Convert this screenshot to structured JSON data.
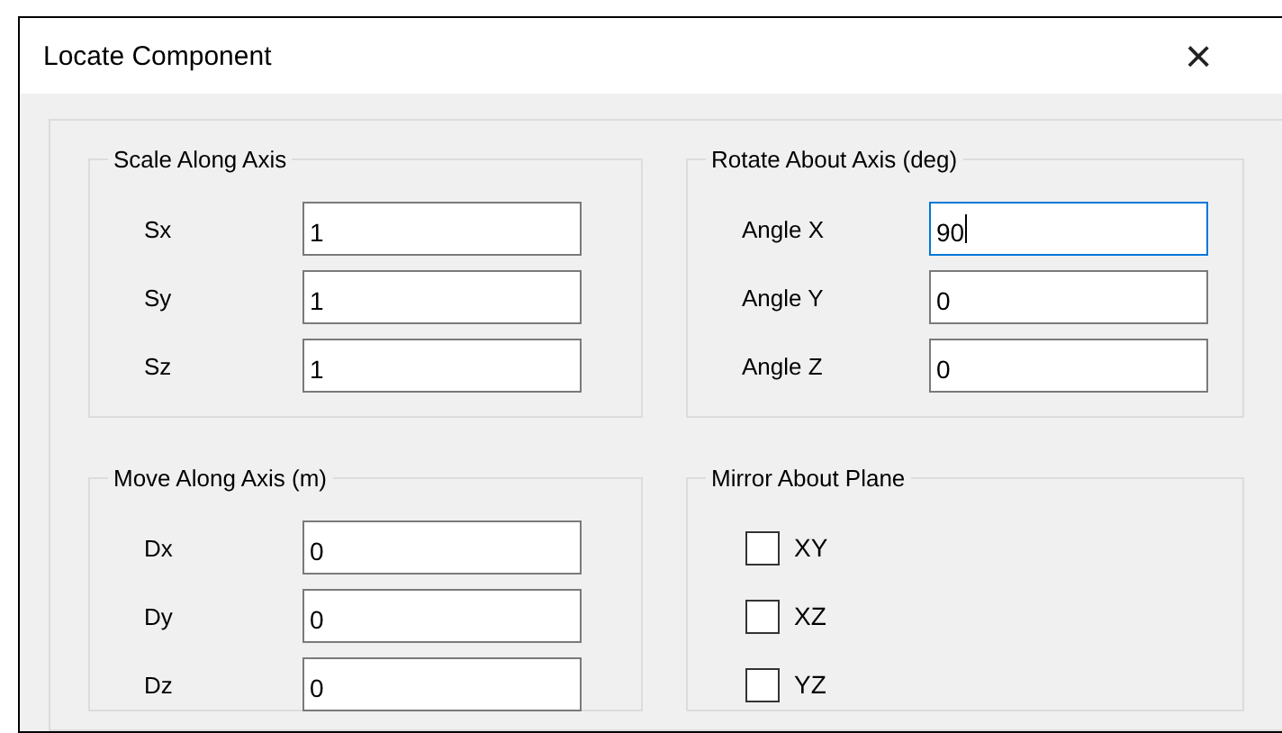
{
  "window": {
    "title": "Locate Component",
    "close": "×"
  },
  "groups": [
    {
      "title": "Scale Along Axis",
      "kind": "fields",
      "fields": [
        {
          "label": "Sx",
          "value": "1",
          "focused": false
        },
        {
          "label": "Sy",
          "value": "1",
          "focused": false
        },
        {
          "label": "Sz",
          "value": "1",
          "focused": false
        }
      ]
    },
    {
      "title": "Rotate About Axis (deg)",
      "kind": "fields",
      "fields": [
        {
          "label": "Angle X",
          "value": "90",
          "focused": true
        },
        {
          "label": "Angle Y",
          "value": "0",
          "focused": false
        },
        {
          "label": "Angle Z",
          "value": "0",
          "focused": false
        }
      ]
    },
    {
      "title": "Move Along Axis (m)",
      "kind": "fields",
      "fields": [
        {
          "label": "Dx",
          "value": "0",
          "focused": false
        },
        {
          "label": "Dy",
          "value": "0",
          "focused": false
        },
        {
          "label": "Dz",
          "value": "0",
          "focused": false
        }
      ]
    },
    {
      "title": "Mirror About Plane",
      "kind": "checks",
      "checks": [
        {
          "label": "XY",
          "checked": false
        },
        {
          "label": "XZ",
          "checked": false
        },
        {
          "label": "YZ",
          "checked": false
        }
      ]
    }
  ]
}
